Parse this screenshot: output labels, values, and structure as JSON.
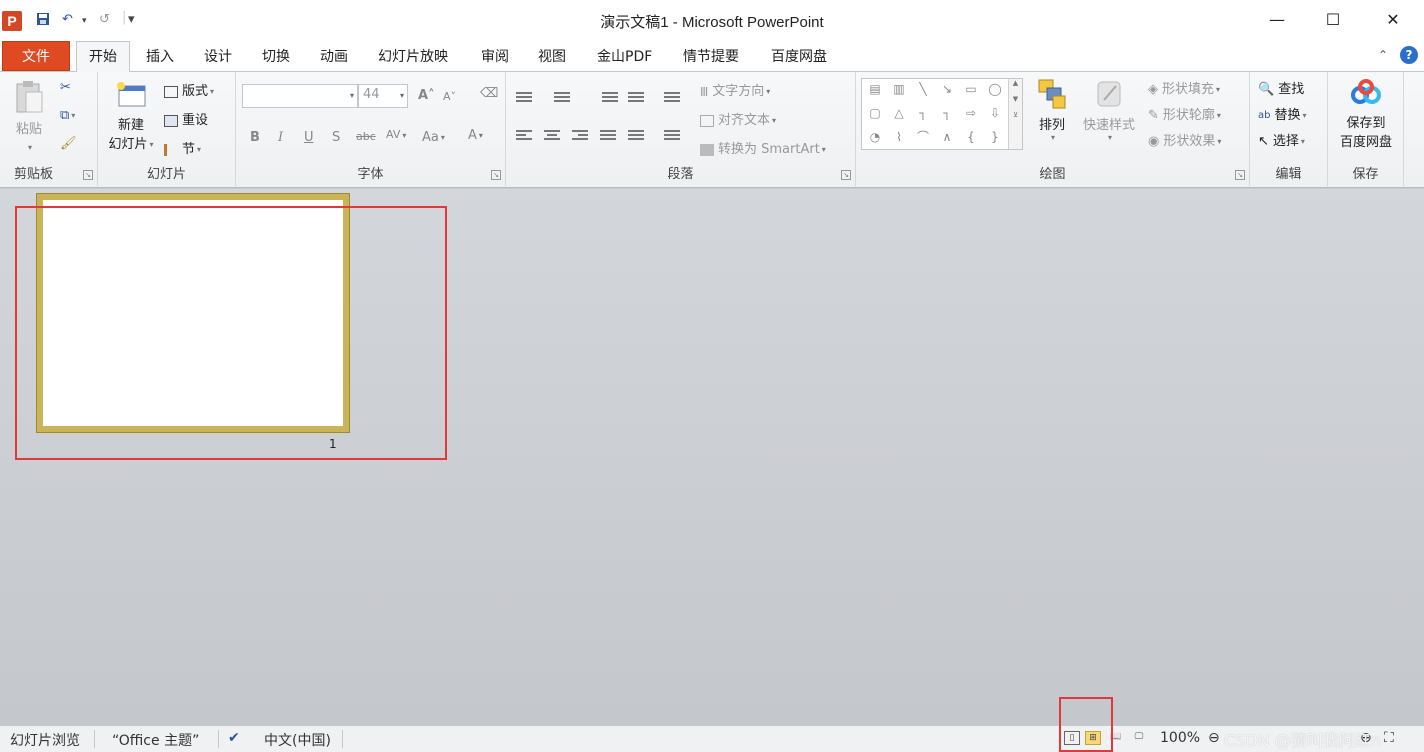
{
  "window": {
    "title": "演示文稿1 - Microsoft PowerPoint",
    "app_icon_letter": "P",
    "controls": {
      "minimize": "—",
      "maximize": "☐",
      "close": "✕"
    }
  },
  "quick_access": {
    "save": "💾",
    "undo": "↶",
    "redo": "↺",
    "customize": "▾"
  },
  "tabs": {
    "file": "文件",
    "items": [
      "开始",
      "插入",
      "设计",
      "切换",
      "动画",
      "幻灯片放映",
      "审阅",
      "视图",
      "金山PDF",
      "情节提要",
      "百度网盘"
    ],
    "active": "开始"
  },
  "ribbon": {
    "clipboard": {
      "label": "剪贴板",
      "paste": "粘贴"
    },
    "slides": {
      "label": "幻灯片",
      "new_slide_1": "新建",
      "new_slide_2": "幻灯片",
      "layout": "版式",
      "reset": "重设",
      "section": "节"
    },
    "font": {
      "label": "字体",
      "font_name": "",
      "font_size": "44",
      "bold": "B",
      "italic": "I",
      "underline": "U",
      "shadow": "S",
      "strike": "abc",
      "spacing": "AV",
      "case": "Aa",
      "color": "A",
      "grow": "A",
      "shrink": "A"
    },
    "paragraph": {
      "label": "段落",
      "text_direction": "文字方向",
      "align_text": "对齐文本",
      "smartart": "转换为 SmartArt"
    },
    "drawing": {
      "label": "绘图",
      "arrange": "排列",
      "quick_styles": "快速样式",
      "shape_fill": "形状填充",
      "shape_outline": "形状轮廓",
      "shape_effects": "形状效果"
    },
    "editing": {
      "label": "编辑",
      "find": "查找",
      "replace": "替换",
      "select": "选择"
    },
    "save": {
      "label": "保存",
      "save_to_1": "保存到",
      "save_to_2": "百度网盘"
    }
  },
  "slide_sorter": {
    "slides": [
      {
        "number": "1"
      }
    ]
  },
  "status": {
    "view_name": "幻灯片浏览",
    "theme": "“Office 主题”",
    "language": "中文(中国)",
    "zoom": "100%"
  },
  "watermark": "CSDN @猜叫我阿红n"
}
